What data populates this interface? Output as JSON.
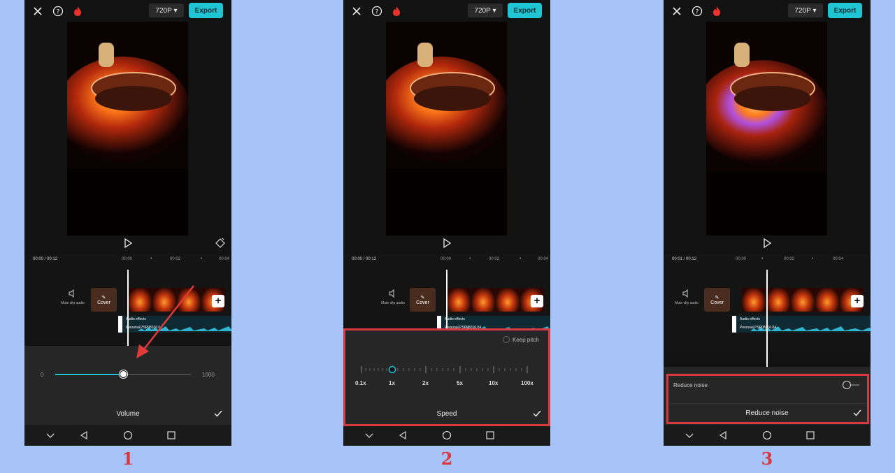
{
  "colors": {
    "background": "#a8c3f7",
    "accent": "#20c5d4",
    "highlight": "#d8383f"
  },
  "common": {
    "resolution": "720P",
    "export_label": "Export",
    "mute_label": "Mute clip audio",
    "cover_label": "Cover",
    "audio_effects_label": "Audio effects",
    "audio_file_name": "Personal PSP08016.04",
    "plus": "+",
    "icons": [
      "close-icon",
      "help-icon",
      "fire-icon",
      "play-icon",
      "keyframe-icon",
      "speaker-icon",
      "edit-icon",
      "chevron-down-icon",
      "back-icon",
      "home-icon",
      "recents-icon",
      "check-icon"
    ]
  },
  "screens": [
    {
      "timecode": "00:00 / 00:12",
      "ruler": [
        "00:00",
        "00:02",
        "00:04"
      ],
      "volume": {
        "min": "0",
        "max": "1000",
        "level": 0.5
      },
      "panel_title": "Volume",
      "step": "1"
    },
    {
      "timecode": "00:00 / 00:12",
      "ruler": [
        "00:00",
        "00:02",
        "00:04"
      ],
      "speed": {
        "keep_pitch_label": "Keep pitch",
        "ticks": [
          "0.1x",
          "1x",
          "2x",
          "5x",
          "10x",
          "100x"
        ],
        "selected": "1x"
      },
      "panel_title": "Speed",
      "step": "2"
    },
    {
      "timecode": "00:01 / 00:12",
      "ruler": [
        "00:00",
        "00:02",
        "00:04"
      ],
      "reduce_noise_toggle_label": "Reduce noise",
      "reduce_noise_on": false,
      "panel_title": "Reduce noise",
      "step": "3"
    }
  ]
}
